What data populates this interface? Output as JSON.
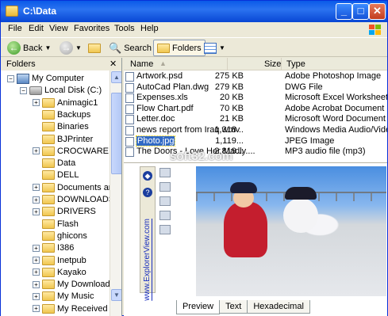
{
  "window": {
    "title": "C:\\Data",
    "buttons": {
      "min": "_",
      "max": "□",
      "close": "✕"
    }
  },
  "menu": [
    "File",
    "Edit",
    "View",
    "Favorites",
    "Tools",
    "Help"
  ],
  "toolbar": {
    "back": "Back",
    "search": "Search",
    "folders": "Folders"
  },
  "panes": {
    "folders_header": "Folders",
    "name_header": "Name",
    "size_header": "Size",
    "type_header": "Type"
  },
  "tree": [
    {
      "label": "My Computer",
      "icon": "computer-icon",
      "expander": "−",
      "level": 0
    },
    {
      "label": "Local Disk (C:)",
      "icon": "disk-icon",
      "expander": "−",
      "level": 1
    },
    {
      "label": "Animagic1",
      "icon": "folder-icon",
      "expander": "+",
      "level": 2
    },
    {
      "label": "Backups",
      "icon": "folder-icon",
      "expander": "",
      "level": 2
    },
    {
      "label": "Binaries",
      "icon": "folder-icon",
      "expander": "",
      "level": 2
    },
    {
      "label": "BJPrinter",
      "icon": "folder-icon",
      "expander": "",
      "level": 2
    },
    {
      "label": "CROCWARE",
      "icon": "folder-icon",
      "expander": "+",
      "level": 2
    },
    {
      "label": "Data",
      "icon": "folder-icon",
      "expander": "",
      "level": 2
    },
    {
      "label": "DELL",
      "icon": "folder-icon",
      "expander": "",
      "level": 2
    },
    {
      "label": "Documents and Settings",
      "icon": "folder-icon",
      "expander": "+",
      "level": 2
    },
    {
      "label": "DOWNLOADS",
      "icon": "folder-icon",
      "expander": "+",
      "level": 2
    },
    {
      "label": "DRIVERS",
      "icon": "folder-icon",
      "expander": "+",
      "level": 2
    },
    {
      "label": "Flash",
      "icon": "folder-icon",
      "expander": "",
      "level": 2
    },
    {
      "label": "ghicons",
      "icon": "folder-icon",
      "expander": "",
      "level": 2
    },
    {
      "label": "I386",
      "icon": "folder-icon",
      "expander": "+",
      "level": 2
    },
    {
      "label": "Inetpub",
      "icon": "folder-icon",
      "expander": "+",
      "level": 2
    },
    {
      "label": "Kayako",
      "icon": "folder-icon",
      "expander": "+",
      "level": 2
    },
    {
      "label": "My Downloads",
      "icon": "folder-icon",
      "expander": "+",
      "level": 2
    },
    {
      "label": "My Music",
      "icon": "folder-icon",
      "expander": "+",
      "level": 2
    },
    {
      "label": "My Received",
      "icon": "folder-icon",
      "expander": "+",
      "level": 2
    }
  ],
  "files": [
    {
      "name": "Artwork.psd",
      "size": "275 KB",
      "type": "Adobe Photoshop Image"
    },
    {
      "name": "AutoCad Plan.dwg",
      "size": "279 KB",
      "type": "DWG File"
    },
    {
      "name": "Expenses.xls",
      "size": "20 KB",
      "type": "Microsoft Excel Worksheet"
    },
    {
      "name": "Flow Chart.pdf",
      "size": "70 KB",
      "type": "Adobe Acrobat Document"
    },
    {
      "name": "Letter.doc",
      "size": "21 KB",
      "type": "Microsoft Word Document"
    },
    {
      "name": "news report from Iraq.wmv",
      "size": "1,318...",
      "type": "Windows Media Audio/Vide..."
    },
    {
      "name": "Photo.jpg",
      "size": "1,119...",
      "type": "JPEG Image",
      "selected": true
    },
    {
      "name": "The Doors - Love Her Madly....",
      "size": "2,819...",
      "type": "MP3 audio file (mp3)"
    }
  ],
  "preview": {
    "side_link": "www.ExplorerView.com",
    "watermark": "soft32.com",
    "tabs": [
      "Preview",
      "Text",
      "Hexadecimal"
    ],
    "active_tab": "Preview"
  },
  "colors": {
    "titlebar": "#0a5ae8",
    "selection": "#316ac5",
    "chrome": "#ece9d8"
  }
}
